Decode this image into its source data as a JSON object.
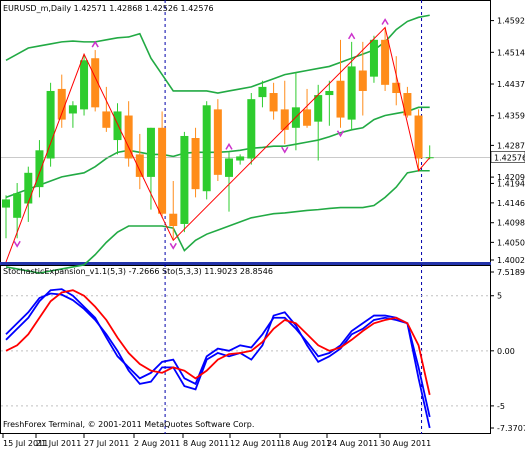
{
  "chart_data": [
    {
      "type": "candlestick",
      "title": "EURUSD_m,Daily 1.42571 1.42868 1.42526 1.42576",
      "price_axis_ticks": [
        "1.45920",
        "1.45145",
        "1.44370",
        "1.43595",
        "1.42870",
        "1.42095",
        "1.41940",
        "1.41465",
        "1.40980",
        "1.40500",
        "1.40020"
      ],
      "ylim": [
        1.4002,
        1.4635
      ],
      "current_price": "1.42576",
      "candles": [
        {
          "o": 1.4135,
          "h": 1.4165,
          "l": 1.406,
          "c": 1.4155
        },
        {
          "o": 1.411,
          "h": 1.4195,
          "l": 1.406,
          "c": 1.417
        },
        {
          "o": 1.4145,
          "h": 1.4235,
          "l": 1.41,
          "c": 1.422
        },
        {
          "o": 1.4185,
          "h": 1.43,
          "l": 1.416,
          "c": 1.4275
        },
        {
          "o": 1.4255,
          "h": 1.444,
          "l": 1.4235,
          "c": 1.442
        },
        {
          "o": 1.4425,
          "h": 1.446,
          "l": 1.433,
          "c": 1.435
        },
        {
          "o": 1.4365,
          "h": 1.4395,
          "l": 1.433,
          "c": 1.4385
        },
        {
          "o": 1.4375,
          "h": 1.451,
          "l": 1.436,
          "c": 1.4495
        },
        {
          "o": 1.45,
          "h": 1.452,
          "l": 1.437,
          "c": 1.438
        },
        {
          "o": 1.437,
          "h": 1.443,
          "l": 1.432,
          "c": 1.433
        },
        {
          "o": 1.43,
          "h": 1.439,
          "l": 1.4265,
          "c": 1.437
        },
        {
          "o": 1.436,
          "h": 1.4395,
          "l": 1.4235,
          "c": 1.4255
        },
        {
          "o": 1.4265,
          "h": 1.4315,
          "l": 1.418,
          "c": 1.421
        },
        {
          "o": 1.421,
          "h": 1.433,
          "l": 1.413,
          "c": 1.433
        },
        {
          "o": 1.433,
          "h": 1.437,
          "l": 1.411,
          "c": 1.412
        },
        {
          "o": 1.412,
          "h": 1.42,
          "l": 1.4055,
          "c": 1.409
        },
        {
          "o": 1.4095,
          "h": 1.432,
          "l": 1.4075,
          "c": 1.431
        },
        {
          "o": 1.4305,
          "h": 1.433,
          "l": 1.416,
          "c": 1.418
        },
        {
          "o": 1.4175,
          "h": 1.4395,
          "l": 1.4155,
          "c": 1.4385
        },
        {
          "o": 1.4375,
          "h": 1.44,
          "l": 1.42,
          "c": 1.4215
        },
        {
          "o": 1.421,
          "h": 1.427,
          "l": 1.4125,
          "c": 1.4255
        },
        {
          "o": 1.425,
          "h": 1.4265,
          "l": 1.424,
          "c": 1.426
        },
        {
          "o": 1.4255,
          "h": 1.4415,
          "l": 1.424,
          "c": 1.44
        },
        {
          "o": 1.4405,
          "h": 1.4445,
          "l": 1.438,
          "c": 1.443
        },
        {
          "o": 1.4415,
          "h": 1.444,
          "l": 1.435,
          "c": 1.437
        },
        {
          "o": 1.4375,
          "h": 1.4445,
          "l": 1.429,
          "c": 1.4325
        },
        {
          "o": 1.433,
          "h": 1.4465,
          "l": 1.4275,
          "c": 1.438
        },
        {
          "o": 1.4375,
          "h": 1.4425,
          "l": 1.433,
          "c": 1.4335
        },
        {
          "o": 1.4345,
          "h": 1.4435,
          "l": 1.425,
          "c": 1.441
        },
        {
          "o": 1.441,
          "h": 1.4445,
          "l": 1.4335,
          "c": 1.442
        },
        {
          "o": 1.4445,
          "h": 1.4545,
          "l": 1.433,
          "c": 1.4355
        },
        {
          "o": 1.435,
          "h": 1.454,
          "l": 1.4325,
          "c": 1.448
        },
        {
          "o": 1.447,
          "h": 1.454,
          "l": 1.436,
          "c": 1.442
        },
        {
          "o": 1.4455,
          "h": 1.4555,
          "l": 1.444,
          "c": 1.4545
        },
        {
          "o": 1.4545,
          "h": 1.4575,
          "l": 1.442,
          "c": 1.4435
        },
        {
          "o": 1.444,
          "h": 1.4505,
          "l": 1.4385,
          "c": 1.4415
        },
        {
          "o": 1.4415,
          "h": 1.443,
          "l": 1.4355,
          "c": 1.436
        },
        {
          "o": 1.436,
          "h": 1.4375,
          "l": 1.4225,
          "c": 1.4255
        },
        {
          "o": 1.4257,
          "h": 1.4287,
          "l": 1.4253,
          "c": 1.4258
        }
      ],
      "bands": {
        "upper": [
          1.4495,
          1.451,
          1.4525,
          1.453,
          1.4535,
          1.454,
          1.4542,
          1.454,
          1.454,
          1.4545,
          1.455,
          1.4552,
          1.456,
          1.45,
          1.446,
          1.442,
          1.442,
          1.442,
          1.442,
          1.4415,
          1.442,
          1.4425,
          1.443,
          1.444,
          1.445,
          1.446,
          1.4465,
          1.447,
          1.4475,
          1.448,
          1.449,
          1.45,
          1.451,
          1.452,
          1.454,
          1.457,
          1.459,
          1.46,
          1.4605
        ],
        "middle": [
          1.416,
          1.417,
          1.418,
          1.419,
          1.42,
          1.421,
          1.4215,
          1.422,
          1.4235,
          1.4255,
          1.427,
          1.4275,
          1.427,
          1.4265,
          1.4265,
          1.426,
          1.4268,
          1.427,
          1.427,
          1.427,
          1.4272,
          1.4275,
          1.428,
          1.4282,
          1.4285,
          1.4285,
          1.429,
          1.4295,
          1.43,
          1.4308,
          1.4318,
          1.4325,
          1.433,
          1.435,
          1.436,
          1.4365,
          1.437,
          1.438,
          1.438
        ],
        "lower": [
          1.399,
          1.3985,
          1.398,
          1.3975,
          1.398,
          1.3985,
          1.399,
          1.3995,
          1.402,
          1.405,
          1.4075,
          1.409,
          1.409,
          1.409,
          1.409,
          1.4085,
          1.403,
          1.4055,
          1.407,
          1.408,
          1.409,
          1.41,
          1.411,
          1.4115,
          1.412,
          1.4122,
          1.4125,
          1.4128,
          1.413,
          1.4133,
          1.4135,
          1.4135,
          1.4135,
          1.414,
          1.416,
          1.4185,
          1.422,
          1.4225,
          1.4225
        ]
      },
      "zigzag": [
        [
          0,
          1.4002
        ],
        [
          7,
          1.451
        ],
        [
          15,
          1.4055
        ],
        [
          34,
          1.4575
        ],
        [
          37,
          1.4225
        ],
        [
          38,
          1.4257
        ]
      ],
      "fractals_up": [
        8,
        20,
        31,
        34
      ],
      "fractals_down": [
        1,
        15,
        25,
        30
      ],
      "period_separators": [
        14,
        37
      ]
    },
    {
      "type": "line",
      "title": "StochasticExpansion_v1.1(5,3) -7.2666 Sto(5,3,3) 11.9023 28.8546",
      "axis_ticks": [
        "7.5189",
        "5",
        "0.00",
        "-5",
        "-7.3707"
      ],
      "ylim": [
        -7.3707,
        7.5189
      ],
      "series": [
        {
          "color": "#0000ff",
          "values": [
            1.5,
            2.5,
            3.5,
            4.8,
            5.2,
            5.1,
            4.6,
            3.8,
            2.8,
            1.5,
            0.0,
            -1.8,
            -3.0,
            -2.8,
            -1.5,
            -1.5,
            -3.2,
            -3.5,
            -0.8,
            -0.2,
            -0.5,
            -0.2,
            -0.8,
            0.5,
            3.2,
            3.5,
            2.3,
            0.5,
            -1.0,
            -0.5,
            0.2,
            1.5,
            2.0,
            2.8,
            3.0,
            2.8,
            2.5,
            -2.5,
            -7.0
          ]
        },
        {
          "color": "#0000ff",
          "values": [
            1.0,
            2.0,
            3.0,
            4.5,
            5.5,
            5.6,
            5.0,
            4.0,
            3.0,
            1.2,
            -0.5,
            -1.5,
            -2.5,
            -2.0,
            -1.0,
            -0.8,
            -2.5,
            -3.0,
            -0.5,
            0.2,
            0.0,
            0.5,
            0.3,
            1.5,
            3.0,
            3.0,
            2.0,
            0.8,
            -0.5,
            -0.2,
            0.5,
            1.8,
            2.5,
            3.2,
            3.2,
            3.0,
            2.5,
            -1.5,
            -6.0
          ]
        },
        {
          "color": "#ff0000",
          "values": [
            0.0,
            0.5,
            1.5,
            3.0,
            4.5,
            5.3,
            5.5,
            5.0,
            4.0,
            2.8,
            1.2,
            -0.2,
            -1.2,
            -1.8,
            -2.0,
            -1.5,
            -1.8,
            -2.5,
            -1.8,
            -0.8,
            -0.3,
            -0.2,
            0.0,
            0.8,
            2.0,
            2.8,
            2.5,
            1.5,
            0.5,
            0.0,
            0.3,
            1.0,
            1.8,
            2.5,
            2.8,
            3.0,
            2.5,
            0.5,
            -4.0
          ]
        }
      ],
      "x_tick_labels": [
        "15 Jul 2011",
        "21 Jul 2011",
        "27 Jul 2011",
        "2 Aug 2011",
        "8 Aug 2011",
        "12 Aug 2011",
        "18 Aug 2011",
        "24 Aug 2011",
        "30 Aug 2011"
      ]
    }
  ],
  "footer": {
    "copyright": "FreshForex Terminal, © 2001-2011 MetaQuotes Software Corp."
  },
  "colors": {
    "bull": "#2ecc2e",
    "bear": "#ff8c1a",
    "band": "#22aa44",
    "zigzag": "#ff0000",
    "fractal": "#cc33cc",
    "separator": "#0000aa",
    "price_line": "#aaaaaa"
  }
}
